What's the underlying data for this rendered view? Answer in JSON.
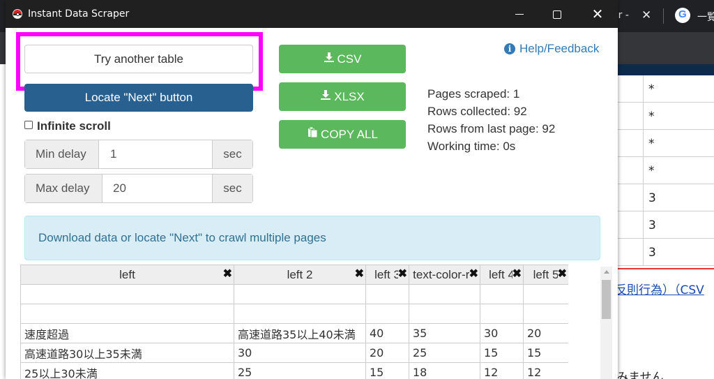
{
  "window": {
    "title": "Instant Data Scraper",
    "minimize_label": "–",
    "close_label": "✕"
  },
  "controls": {
    "try_another_table": "Try another table",
    "locate_next": "Locate \"Next\" button",
    "infinite_scroll": "Infinite scroll",
    "min_delay_label": "Min delay",
    "min_delay_value": "1",
    "min_delay_unit": "sec",
    "max_delay_label": "Max delay",
    "max_delay_value": "20",
    "max_delay_unit": "sec"
  },
  "export": {
    "csv": "CSV",
    "xlsx": "XLSX",
    "copy_all": "COPY ALL",
    "download_icon": "download-icon",
    "clipboard_icon": "clipboard-icon"
  },
  "help": {
    "label": "Help/Feedback",
    "icon": "info-icon"
  },
  "stats": {
    "pages_scraped": "Pages scraped: 1",
    "rows_collected": "Rows collected: 92",
    "rows_last_page": "Rows from last page: 92",
    "working_time": "Working time: 0s"
  },
  "info_message": "Download data or locate \"Next\" to crawl multiple pages",
  "table": {
    "columns": [
      "left",
      "left 2",
      "left 3",
      "text-color-re",
      "left 4",
      "left 5"
    ],
    "rows": [
      [
        "",
        "",
        "",
        "",
        "",
        ""
      ],
      [
        "",
        "",
        "",
        "",
        "",
        ""
      ],
      [
        "速度超過",
        "高速道路35以上40未満",
        "40",
        "35",
        "30",
        "20"
      ],
      [
        "高速道路30以上35未満",
        "30",
        "20",
        "25",
        "15",
        "15"
      ],
      [
        "25以上30未満",
        "25",
        "15",
        "18",
        "12",
        "12"
      ]
    ]
  },
  "background": {
    "tab_text": "er -",
    "tab_close": "✕",
    "tab2_text": "一覧",
    "cells": [
      "*",
      "*",
      "*",
      "*",
      "3",
      "3",
      "3"
    ],
    "link_text": "反則行為）（CSV",
    "bottom_text": "みません",
    "accent_red": "#e33333"
  },
  "highlight_color": "#ff00ff"
}
